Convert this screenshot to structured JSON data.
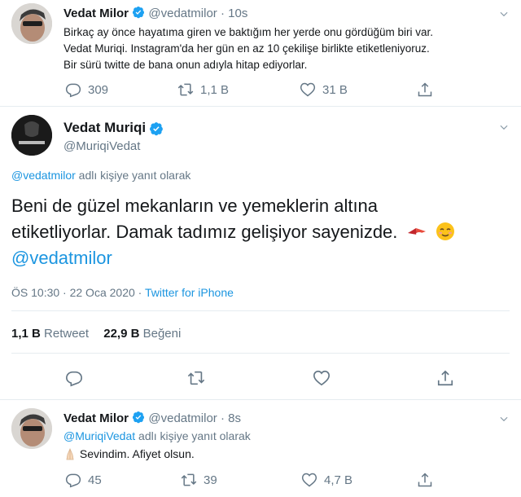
{
  "top_tweet": {
    "name": "Vedat Milor",
    "handle": "@vedatmilor",
    "time": "· 10s",
    "text_lines": [
      "Birkaç ay önce hayatıma giren ve baktığım her yerde onu gördüğüm biri var.",
      "Vedat Muriqi. Instagram'da her gün en az 10 çekilişe birlikte etiketleniyoruz.",
      "Bir sürü twitte de bana onun adıyla hitap ediyorlar."
    ],
    "replies": "309",
    "retweets": "1,1 B",
    "likes": "31 B"
  },
  "main_tweet": {
    "name": "Vedat Muriqi",
    "handle": "@MuriqiVedat",
    "reply_to_handle": "@vedatmilor",
    "reply_to_suffix": " adlı kişiye yanıt olarak",
    "text_line1": "Beni de güzel mekanların ve yemeklerin altına",
    "text_line2": "etiketliyorlar. Damak tadımız gelişiyor sayenizde.",
    "mention": "@vedatmilor",
    "time_date": "ÖS 10:30 · 22 Oca 2020 · ",
    "source": "Twitter for iPhone",
    "retweet_count": "1,1 B",
    "retweet_label": "Retweet",
    "like_count": "22,9 B",
    "like_label": "Beğeni"
  },
  "reply_tweet": {
    "name": "Vedat Milor",
    "handle": "@vedatmilor",
    "time": "· 8s",
    "reply_to_handle": "@MuriqiVedat",
    "reply_to_suffix": " adlı kişiye yanıt olarak",
    "text": "Sevindim. Afiyet olsun.",
    "replies": "45",
    "retweets": "39",
    "likes": "4,7 B"
  },
  "colors": {
    "link": "#1b95e0",
    "muted": "#657786",
    "divider": "#e6ecf0",
    "verified": "#1da1f2"
  }
}
